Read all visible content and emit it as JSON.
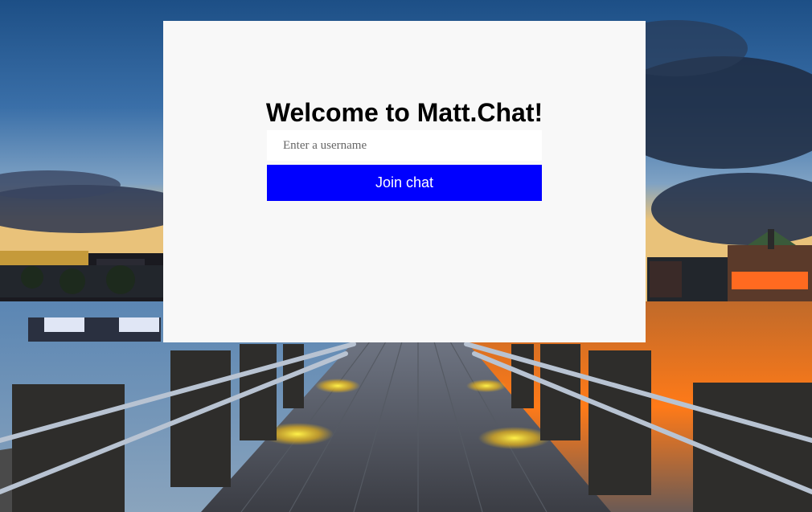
{
  "login": {
    "title": "Welcome to Matt.Chat!",
    "username_placeholder": "Enter a username",
    "username_value": "",
    "join_label": "Join chat"
  },
  "colors": {
    "panel_background": "#f8f8f8",
    "button_background": "#0000ff",
    "button_text": "#ffffff"
  }
}
